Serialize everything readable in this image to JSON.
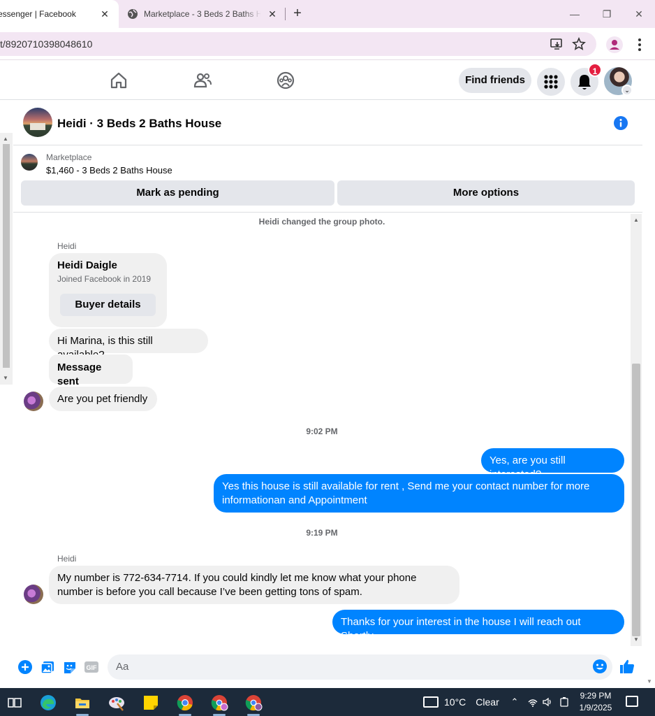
{
  "browser": {
    "tabs": [
      {
        "title": "essenger | Facebook",
        "active": true
      },
      {
        "title": "Marketplace - 3 Beds 2 Baths H",
        "active": false
      }
    ],
    "url": "t/8920710398048610"
  },
  "fb_nav": {
    "find_friends_label": "Find friends",
    "notification_count": "1"
  },
  "chat": {
    "title": "Heidi · 3 Beds 2 Baths House",
    "listing": {
      "label": "Marketplace",
      "price_title": "$1,460 - 3 Beds 2 Baths House",
      "pending_button": "Mark as pending",
      "more_button": "More options"
    },
    "system_note": "Heidi changed the group photo.",
    "sender_name": "Heidi",
    "profile_card": {
      "name": "Heidi Daigle",
      "joined": "Joined Facebook in 2019",
      "button": "Buyer details"
    },
    "messages": [
      {
        "from": "Heidi",
        "text": "Hi Marina, is this still available?"
      },
      {
        "from": "Heidi",
        "text": "Message sent"
      },
      {
        "from": "Heidi",
        "text": "Are you pet friendly"
      },
      {
        "from": "me",
        "text": "Yes, are you still interested?"
      },
      {
        "from": "me",
        "text": "Yes this house is still available for rent , Send me your contact number for more informationan and Appointment"
      },
      {
        "from": "Heidi",
        "text": "My number is 772-634-7714. If you could kindly let me know what your phone number is before you call because I’ve been getting tons of spam."
      },
      {
        "from": "me",
        "text": "Thanks for your interest in the house I will reach out Shortly"
      }
    ],
    "timestamps": [
      "9:02 PM",
      "9:19 PM"
    ],
    "composer_placeholder": "Aa"
  },
  "taskbar": {
    "weather_temp": "10°C",
    "weather_condition": "Clear",
    "time": "9:29 PM",
    "date": "1/9/2025"
  },
  "colors": {
    "messenger_blue": "#0084ff",
    "fb_blue": "#1877f2",
    "notification_red": "#e41e3f"
  }
}
